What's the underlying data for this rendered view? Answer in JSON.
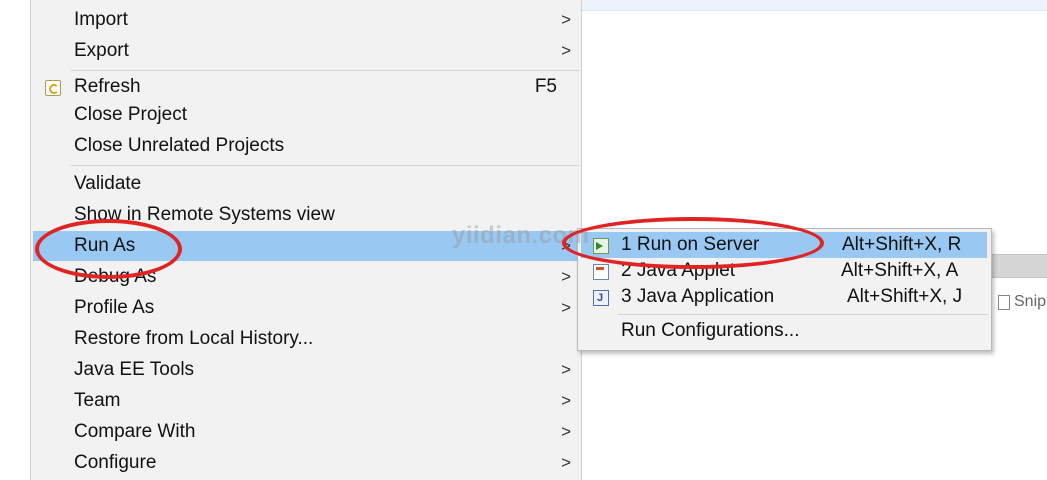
{
  "context_menu": {
    "items": [
      {
        "label": "Import",
        "has_submenu": true
      },
      {
        "label": "Export",
        "has_submenu": true
      },
      {
        "label": "Refresh",
        "accelerator": "F5",
        "icon": "refresh-icon"
      },
      {
        "label": "Close Project"
      },
      {
        "label": "Close Unrelated Projects"
      },
      {
        "label": "Validate"
      },
      {
        "label": "Show in Remote Systems view"
      },
      {
        "label": "Run As",
        "has_submenu": true,
        "highlighted": true
      },
      {
        "label": "Debug As",
        "has_submenu": true
      },
      {
        "label": "Profile As",
        "has_submenu": true
      },
      {
        "label": "Restore from Local History..."
      },
      {
        "label": "Java EE Tools",
        "has_submenu": true
      },
      {
        "label": "Team",
        "has_submenu": true
      },
      {
        "label": "Compare With",
        "has_submenu": true
      },
      {
        "label": "Configure",
        "has_submenu": true
      }
    ],
    "submenu_arrow": ">"
  },
  "run_as_submenu": {
    "items": [
      {
        "label": "1 Run on Server",
        "accelerator": "Alt+Shift+X, R",
        "icon": "server-run-icon",
        "highlighted": true
      },
      {
        "label": "2 Java Applet",
        "accelerator": "Alt+Shift+X, A",
        "icon": "java-applet-icon"
      },
      {
        "label": "3 Java Application",
        "accelerator": "Alt+Shift+X, J",
        "icon": "java-application-icon"
      },
      {
        "label": "Run Configurations..."
      }
    ]
  },
  "background": {
    "tab_fragment": "Snip"
  },
  "watermark": "yiidian.com",
  "colors": {
    "menu_bg": "#f2f2f2",
    "highlight": "#99c9f3",
    "annotation_ring": "#e02424"
  }
}
